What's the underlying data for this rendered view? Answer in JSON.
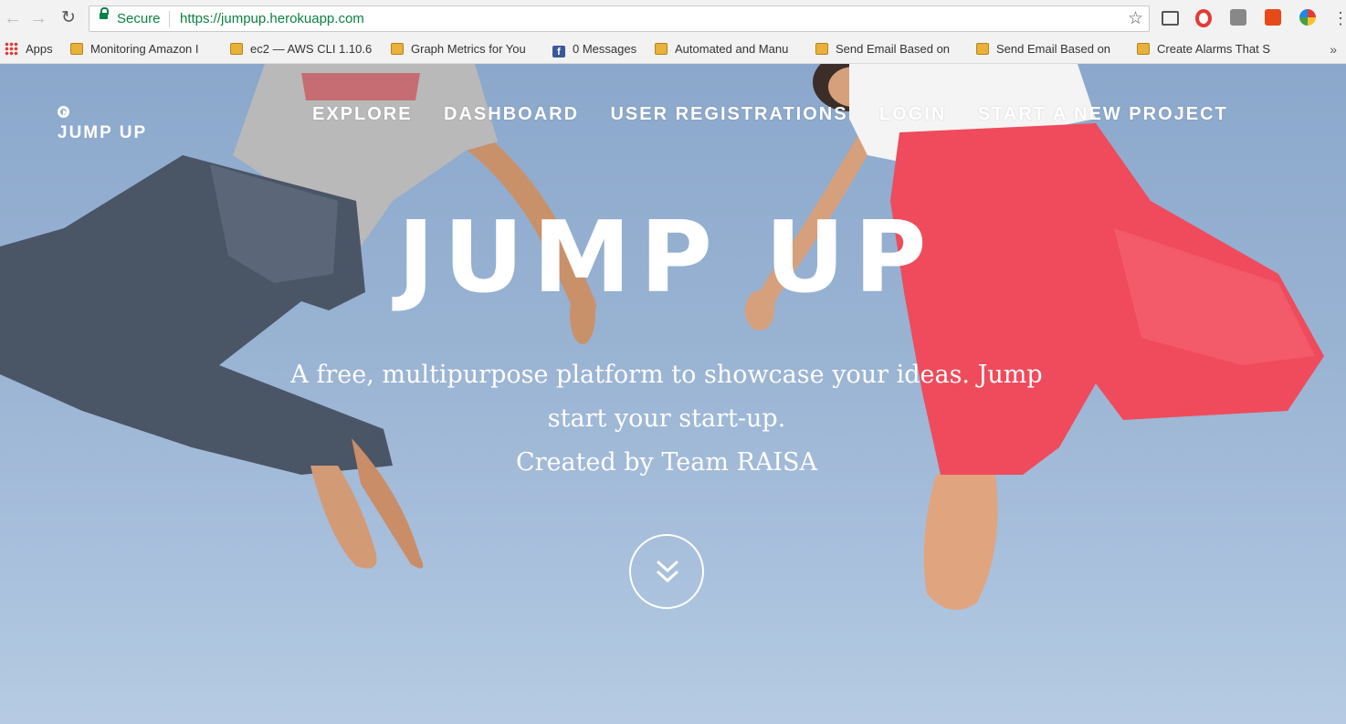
{
  "browser": {
    "back_icon": "back-arrow-icon",
    "forward_icon": "forward-arrow-icon",
    "reload_icon": "reload-icon",
    "secure_label": "Secure",
    "url": "https://jumpup.herokuapp.com",
    "bookmarks": [
      {
        "label": "Apps",
        "icon": "apps-grid-icon"
      },
      {
        "label": "Monitoring Amazon I",
        "icon": "bookmark-page-icon"
      },
      {
        "label": "ec2 — AWS CLI 1.10.6",
        "icon": "bookmark-page-icon"
      },
      {
        "label": "Graph Metrics for You",
        "icon": "bookmark-page-icon"
      },
      {
        "label": "0 Messages",
        "icon": "facebook-icon"
      },
      {
        "label": "Automated and Manu",
        "icon": "bookmark-page-icon"
      },
      {
        "label": "Send Email Based on",
        "icon": "bookmark-page-icon"
      },
      {
        "label": "Send Email Based on",
        "icon": "bookmark-page-icon"
      },
      {
        "label": "Create Alarms That S",
        "icon": "bookmark-page-icon"
      }
    ],
    "more_bookmarks": "»"
  },
  "site": {
    "logo_text": "JUMP UP",
    "nav": [
      "EXPLORE",
      "DASHBOARD",
      "USER REGISTRATIONS",
      "LOGIN",
      "START A NEW PROJECT"
    ],
    "hero_title": "JUMP UP",
    "tagline_line1": "A free, multipurpose platform to showcase your ideas. Jump",
    "tagline_line2": "start your start-up.",
    "tagline_line3": "Created by Team RAISA",
    "scroll_icon": "double-chevron-down-icon"
  }
}
